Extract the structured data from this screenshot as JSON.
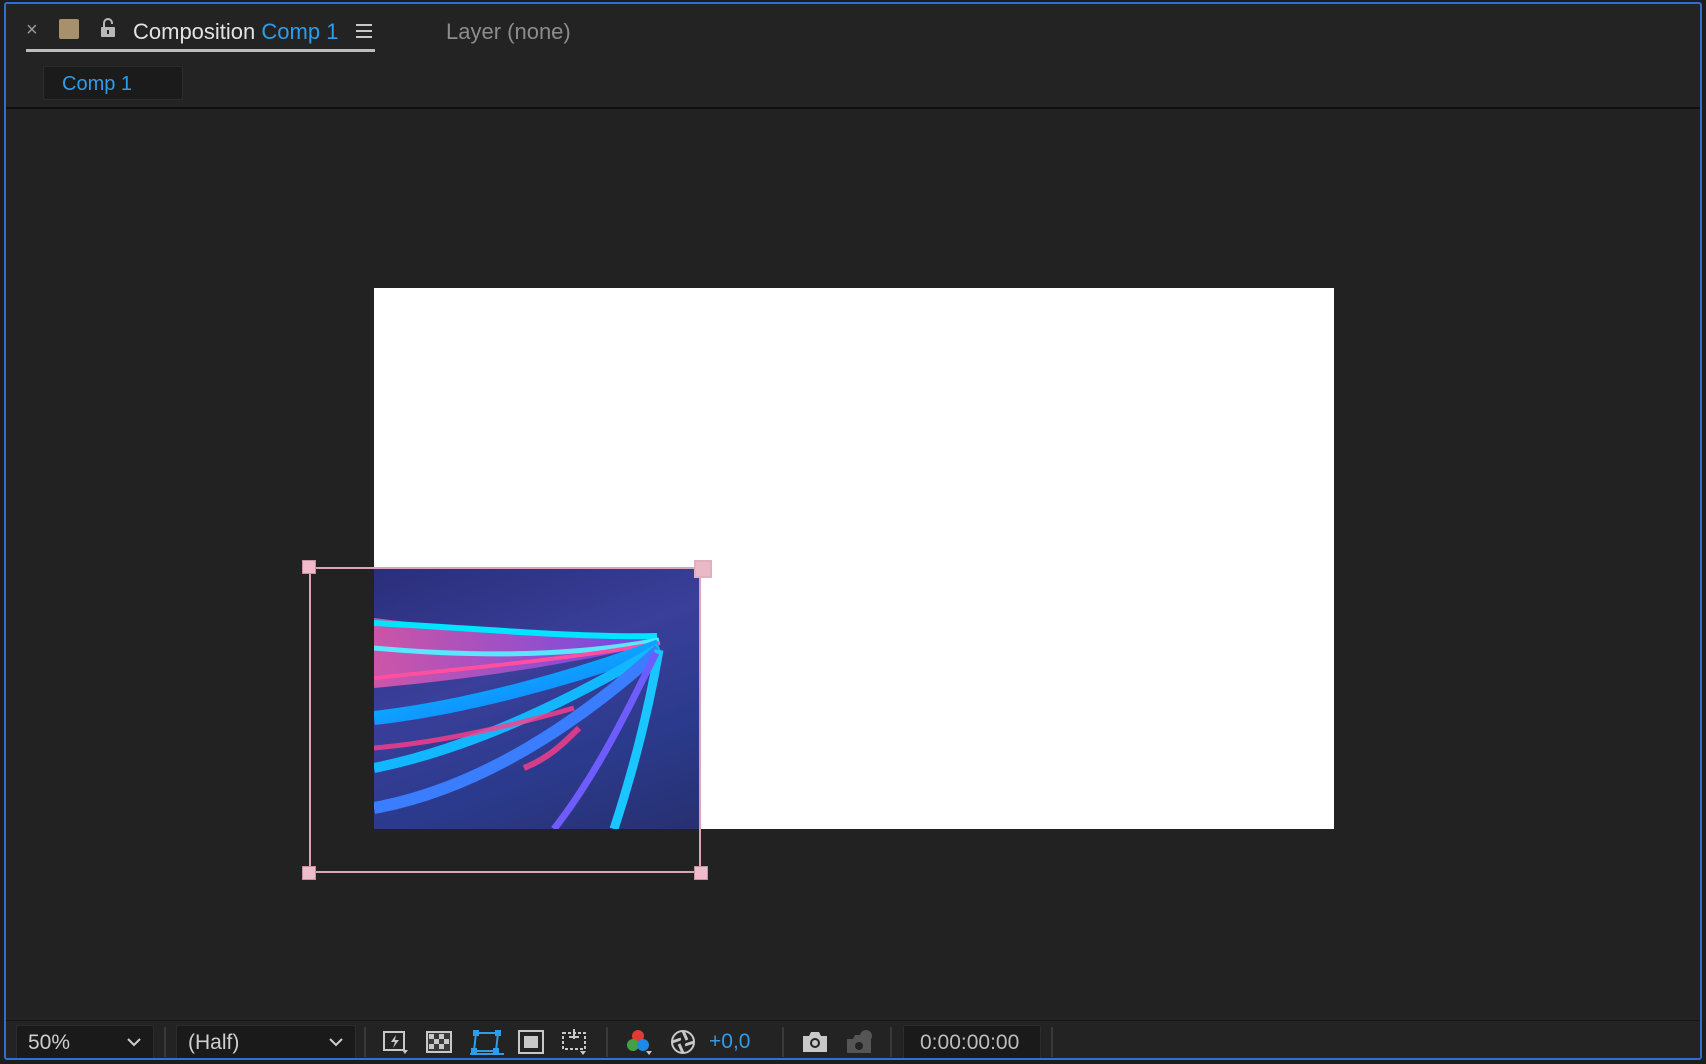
{
  "header": {
    "close_glyph": "×",
    "title_prefix": "Composition",
    "title_comp": "Comp 1",
    "layer_tab": "Layer (none)"
  },
  "breadcrumb": {
    "label": "Comp 1"
  },
  "toolbar": {
    "zoom": "50%",
    "resolution": "(Half)",
    "exposure": "+0,0",
    "timecode": "0:00:00:00"
  },
  "icons": {
    "label_color": "#a7906c",
    "accent": "#2f9ce8",
    "panel_border": "#2f6fd1",
    "selection": "#f0bccb"
  }
}
